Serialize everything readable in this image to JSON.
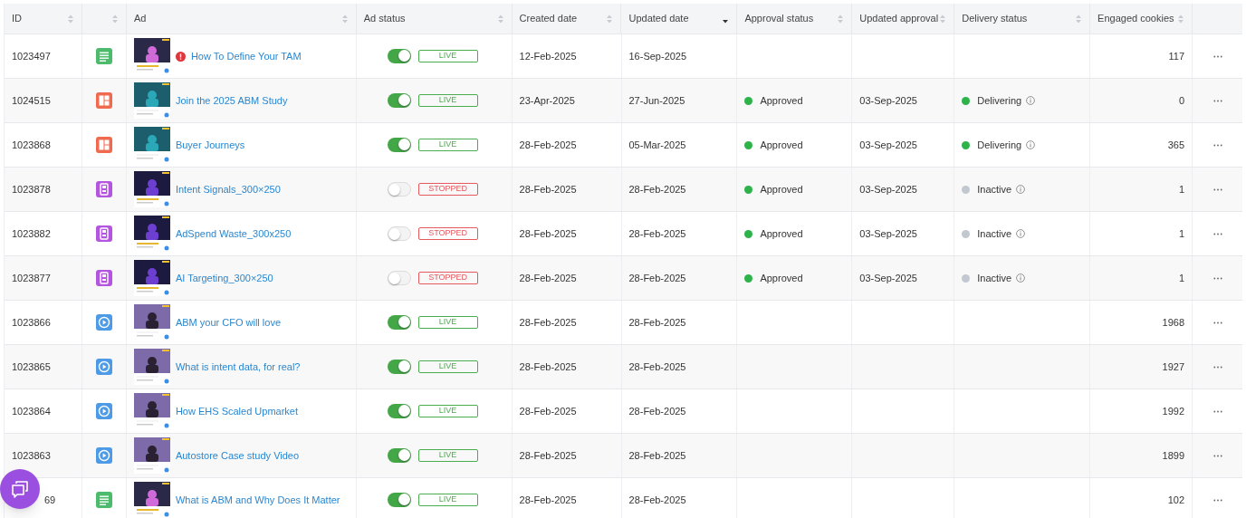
{
  "table": {
    "columns": [
      {
        "label": "ID",
        "sort_active": false
      },
      {
        "sort_active": false
      },
      {
        "label": "Ad",
        "sort_active": false
      },
      {
        "label": "Ad status",
        "sort_active": false
      },
      {
        "label": "Created date",
        "sort_active": false
      },
      {
        "label": "Updated date",
        "sort_active": true
      },
      {
        "label": "Approval status",
        "sort_active": false
      },
      {
        "label": "Updated approval",
        "sort_active": false
      },
      {
        "label": "Delivery status",
        "sort_active": false
      },
      {
        "label": "Engaged cookies",
        "sort_active": false
      }
    ],
    "rows": [
      {
        "id": "1023497",
        "id_partial": false,
        "kind": "document",
        "alert": true,
        "ad": "How To Define Your TAM",
        "on": true,
        "status": "LIVE",
        "created": "12-Feb-2025",
        "updated": "16-Sep-2025",
        "cookies": "117"
      },
      {
        "id": "1024515",
        "id_partial": false,
        "kind": "grid",
        "alert": false,
        "ad": "Join the 2025 ABM Study",
        "on": true,
        "status": "LIVE",
        "created": "23-Apr-2025",
        "updated": "27-Jun-2025",
        "approval": {
          "label": "Approved",
          "color": "#2db34a"
        },
        "approval_date": "03-Sep-2025",
        "delivery": {
          "label": "Delivering",
          "color": "#2db34a"
        },
        "cookies": "0"
      },
      {
        "id": "1023868",
        "id_partial": false,
        "kind": "grid",
        "alert": false,
        "ad": "Buyer Journeys",
        "on": true,
        "status": "LIVE",
        "created": "28-Feb-2025",
        "updated": "05-Mar-2025",
        "approval": {
          "label": "Approved",
          "color": "#2db34a"
        },
        "approval_date": "03-Sep-2025",
        "delivery": {
          "label": "Delivering",
          "color": "#2db34a"
        },
        "cookies": "365"
      },
      {
        "id": "1023878",
        "id_partial": false,
        "kind": "banner",
        "alert": false,
        "ad": "Intent Signals_300×250",
        "on": false,
        "status": "STOPPED",
        "created": "28-Feb-2025",
        "updated": "28-Feb-2025",
        "approval": {
          "label": "Approved",
          "color": "#2db34a"
        },
        "approval_date": "03-Sep-2025",
        "delivery": {
          "label": "Inactive",
          "color": "#c2c8cf"
        },
        "cookies": "1"
      },
      {
        "id": "1023882",
        "id_partial": false,
        "kind": "banner",
        "alert": false,
        "ad": "AdSpend Waste_300x250",
        "on": false,
        "status": "STOPPED",
        "created": "28-Feb-2025",
        "updated": "28-Feb-2025",
        "approval": {
          "label": "Approved",
          "color": "#2db34a"
        },
        "approval_date": "03-Sep-2025",
        "delivery": {
          "label": "Inactive",
          "color": "#c2c8cf"
        },
        "cookies": "1"
      },
      {
        "id": "1023877",
        "id_partial": false,
        "kind": "banner",
        "alert": false,
        "ad": "AI Targeting_300×250",
        "on": false,
        "status": "STOPPED",
        "created": "28-Feb-2025",
        "updated": "28-Feb-2025",
        "approval": {
          "label": "Approved",
          "color": "#2db34a"
        },
        "approval_date": "03-Sep-2025",
        "delivery": {
          "label": "Inactive",
          "color": "#c2c8cf"
        },
        "cookies": "1"
      },
      {
        "id": "1023866",
        "id_partial": false,
        "kind": "video",
        "alert": false,
        "ad": "ABM your CFO will love",
        "on": true,
        "status": "LIVE",
        "created": "28-Feb-2025",
        "updated": "28-Feb-2025",
        "cookies": "1968"
      },
      {
        "id": "1023865",
        "id_partial": false,
        "kind": "video",
        "alert": false,
        "ad": "What is intent data, for real?",
        "on": true,
        "status": "LIVE",
        "created": "28-Feb-2025",
        "updated": "28-Feb-2025",
        "cookies": "1927"
      },
      {
        "id": "1023864",
        "id_partial": false,
        "kind": "video",
        "alert": false,
        "ad": "How EHS Scaled Upmarket",
        "on": true,
        "status": "LIVE",
        "created": "28-Feb-2025",
        "updated": "28-Feb-2025",
        "cookies": "1992"
      },
      {
        "id": "1023863",
        "id_partial": false,
        "kind": "video",
        "alert": false,
        "ad": "Autostore Case study Video",
        "on": true,
        "status": "LIVE",
        "created": "28-Feb-2025",
        "updated": "28-Feb-2025",
        "cookies": "1899"
      },
      {
        "id": "69",
        "id_partial": true,
        "kind": "document",
        "alert": false,
        "ad": "What is ABM and Why Does It Matter",
        "on": true,
        "status": "LIVE",
        "created": "28-Feb-2025",
        "updated": "28-Feb-2025",
        "cookies": "102"
      }
    ]
  }
}
